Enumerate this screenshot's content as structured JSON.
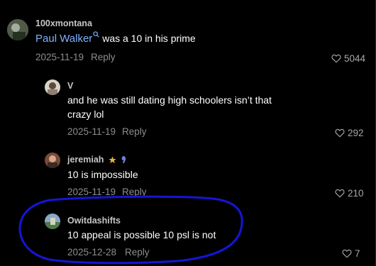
{
  "comments": [
    {
      "username": "100xmontana",
      "mention": "Paul Walker",
      "text": " was a 10 in his prime",
      "date": "2025-11-19",
      "reply": "Reply",
      "likes": "5044"
    },
    {
      "username": "V",
      "text_line1": "and he was still dating high schoolers isn’t that",
      "text_line2": "crazy lol",
      "date": "2025-11-19",
      "reply": "Reply",
      "likes": "292"
    },
    {
      "username": "jeremiah",
      "text": "10 is impossible",
      "date": "2025-11-19",
      "reply": "Reply",
      "likes": "210"
    },
    {
      "username": "Owitdashifts",
      "text": "10 appeal is possible 10 psl is not",
      "date": "2025-12-28",
      "reply": "Reply",
      "likes": "7"
    }
  ],
  "colors": {
    "background": "#000000",
    "mention": "#7fb2ff",
    "annotation_circle": "#1515d6"
  },
  "icons": [
    "heart-outline-icon",
    "search-icon",
    "star-icon",
    "badge-icon"
  ]
}
